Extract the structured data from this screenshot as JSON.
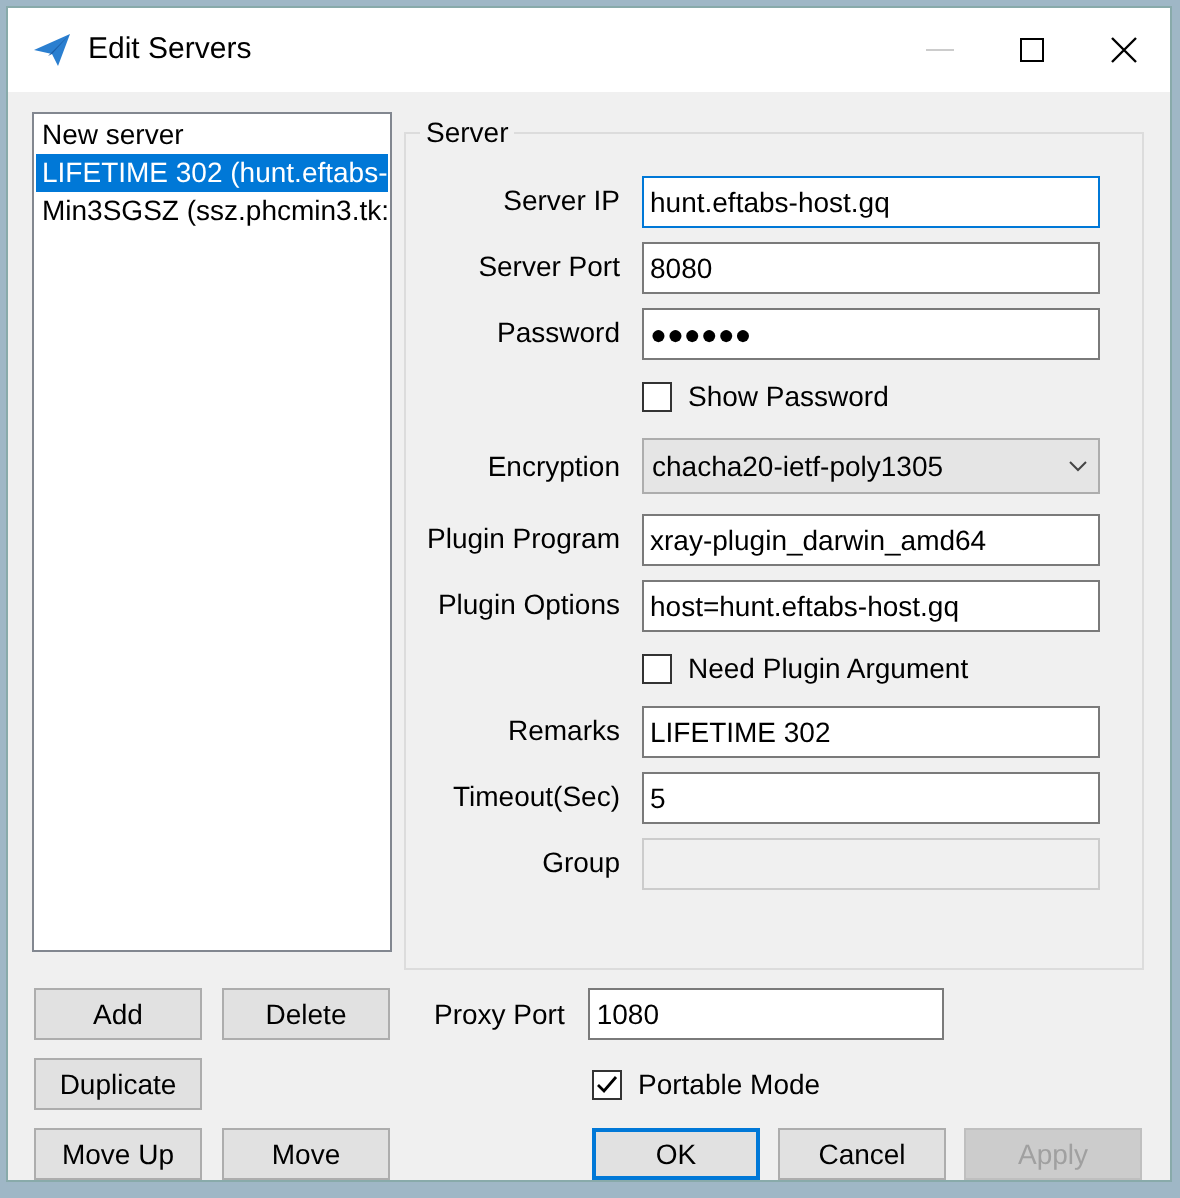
{
  "window": {
    "title": "Edit Servers",
    "controls": [
      {
        "kind": "minimize",
        "disabled": true
      },
      {
        "kind": "maximize",
        "disabled": false
      },
      {
        "kind": "close",
        "disabled": false
      }
    ]
  },
  "servers": [
    {
      "label": "New server",
      "selected": false
    },
    {
      "label": "LIFETIME 302 (hunt.eftabs-",
      "selected": true
    },
    {
      "label": "Min3SGSZ (ssz.phcmin3.tk:",
      "selected": false
    }
  ],
  "list_buttons": [
    [
      {
        "label": "Add"
      },
      {
        "label": "Delete"
      }
    ],
    [
      {
        "label": "Duplicate"
      }
    ],
    [
      {
        "label": "Move Up"
      },
      {
        "label": "Move"
      }
    ]
  ],
  "server_group": {
    "title": "Server",
    "fields": [
      {
        "kind": "text",
        "label": "Server IP",
        "value": "hunt.eftabs-host.gq",
        "focused": true,
        "disabled": false
      },
      {
        "kind": "text",
        "label": "Server Port",
        "value": "8080",
        "focused": false,
        "disabled": false
      },
      {
        "kind": "password",
        "label": "Password",
        "value": "●●●●●●",
        "focused": false,
        "disabled": false
      },
      {
        "kind": "checkbox",
        "label": "Show Password",
        "checked": false
      },
      {
        "kind": "select",
        "label": "Encryption",
        "value": "chacha20-ietf-poly1305"
      },
      {
        "kind": "text",
        "label": "Plugin Program",
        "value": "xray-plugin_darwin_amd64",
        "focused": false,
        "disabled": false
      },
      {
        "kind": "text",
        "label": "Plugin Options",
        "value": "host=hunt.eftabs-host.gq",
        "focused": false,
        "disabled": false
      },
      {
        "kind": "checkbox",
        "label": "Need Plugin Argument",
        "checked": false
      },
      {
        "kind": "text",
        "label": "Remarks",
        "value": "LIFETIME 302",
        "focused": false,
        "disabled": false
      },
      {
        "kind": "text",
        "label": "Timeout(Sec)",
        "value": "5",
        "focused": false,
        "disabled": false
      },
      {
        "kind": "text",
        "label": "Group",
        "focused": false,
        "disabled": true
      }
    ]
  },
  "proxy_port": {
    "label": "Proxy Port",
    "value": "1080"
  },
  "portable_mode": {
    "label": "Portable Mode",
    "checked": true
  },
  "dialog_buttons": [
    {
      "label": "OK",
      "default": true,
      "disabled": false
    },
    {
      "label": "Cancel",
      "default": false,
      "disabled": false
    },
    {
      "label": "Apply",
      "default": false,
      "disabled": true
    }
  ]
}
